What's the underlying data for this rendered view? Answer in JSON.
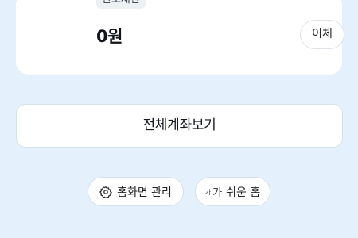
{
  "account_card": {
    "limit_badge": "한도제한",
    "balance": "0원",
    "transfer_label": "이체"
  },
  "all_accounts_label": "전체계좌보기",
  "bottom_actions": {
    "home_settings_label": "홈화면 관리",
    "easy_home_small_glyph": "가",
    "easy_home_big_glyph": "가",
    "easy_home_label": "쉬운 홈"
  },
  "colors": {
    "background": "#e4f1fd",
    "card": "#ffffff",
    "border": "#d8e1ea"
  }
}
